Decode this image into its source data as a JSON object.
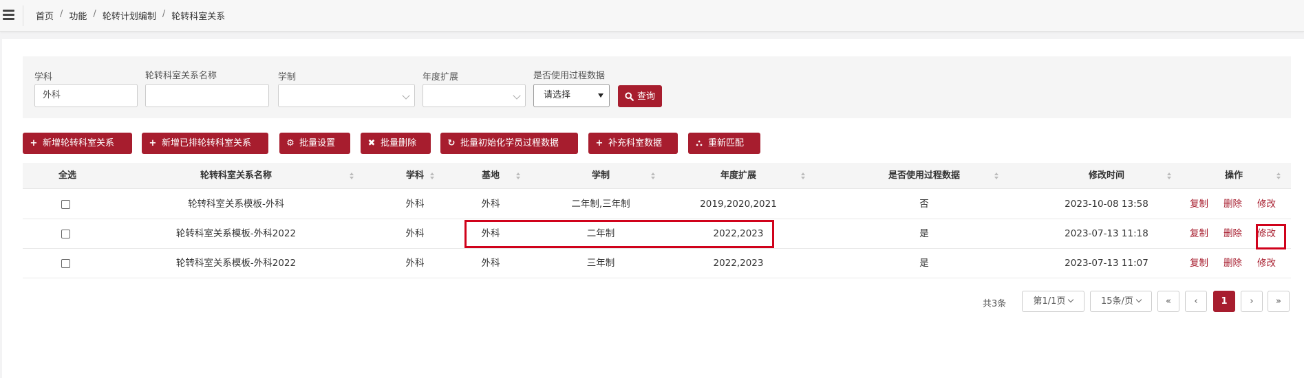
{
  "breadcrumb": [
    "首页",
    "功能",
    "轮转计划编制",
    "轮转科室关系"
  ],
  "breadcrumb_sep": "/",
  "filters": {
    "subject_label": "学科",
    "subject_value": "外科",
    "relation_name_label": "轮转科室关系名称",
    "relation_name_value": "",
    "system_label": "学制",
    "system_value": "",
    "year_label": "年度扩展",
    "year_value": "",
    "process_label": "是否使用过程数据",
    "process_value": "请选择",
    "search_label": "查询"
  },
  "toolbar": [
    {
      "icon": "+",
      "label": "新增轮转科室关系"
    },
    {
      "icon": "+",
      "label": "新增已排轮转科室关系"
    },
    {
      "icon": "⚙",
      "label": "批量设置"
    },
    {
      "icon": "✖",
      "label": "批量删除"
    },
    {
      "icon": "↻",
      "label": "批量初始化学员过程数据"
    },
    {
      "icon": "+",
      "label": "补充科室数据"
    },
    {
      "icon": "⛬",
      "label": "重新匹配"
    }
  ],
  "table": {
    "headers": [
      "全选",
      "轮转科室关系名称",
      "学科",
      "基地",
      "学制",
      "年度扩展",
      "是否使用过程数据",
      "修改时间",
      "操作"
    ],
    "rows": [
      {
        "name": "轮转科室关系模板-外科",
        "subject": "外科",
        "base": "外科",
        "system": "二年制,三年制",
        "year": "2019,2020,2021",
        "process": "否",
        "time": "2023-10-08 13:58"
      },
      {
        "name": "轮转科室关系模板-外科2022",
        "subject": "外科",
        "base": "外科",
        "system": "二年制",
        "year": "2022,2023",
        "process": "是",
        "time": "2023-07-13 11:18"
      },
      {
        "name": "轮转科室关系模板-外科2022",
        "subject": "外科",
        "base": "外科",
        "system": "三年制",
        "year": "2022,2023",
        "process": "是",
        "time": "2023-07-13 11:07"
      }
    ],
    "ops": {
      "copy": "复制",
      "delete": "删除",
      "edit": "修改"
    }
  },
  "pagination": {
    "total": "共3条",
    "page_select": "第1/1页",
    "size_select": "15条/页",
    "first": "«",
    "prev": "‹",
    "current": "1",
    "next": "›",
    "last": "»"
  },
  "colors": {
    "accent": "#a71d2e",
    "highlight": "#d0021b"
  }
}
